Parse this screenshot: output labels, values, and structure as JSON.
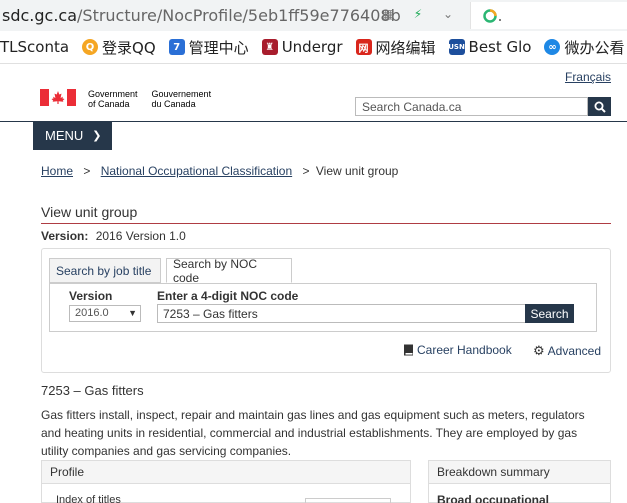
{
  "browser": {
    "url_host": "sdc.gc.ca",
    "url_path": "/Structure/NocProfile/5eb1ff59e776408b",
    "bookmarks": [
      {
        "label": "TLSconta",
        "icon": "document-icon",
        "color": "#ffffff"
      },
      {
        "label": "登录QQ",
        "icon": "qq-icon",
        "color": "#f5a623"
      },
      {
        "label": "管理中心",
        "icon": "seven-icon",
        "color": "#2a6fd6"
      },
      {
        "label": "Undergr",
        "icon": "shield-icon",
        "color": "#a81d2d"
      },
      {
        "label": "网络编辑",
        "icon": "net-icon",
        "color": "#d9261c"
      },
      {
        "label": "Best Glo",
        "icon": "usn-icon",
        "color": "#1d4f9c"
      },
      {
        "label": "微办公看",
        "icon": "bubble-icon",
        "color": "#1e88e5"
      }
    ]
  },
  "header": {
    "language_link": "Français",
    "gov_en_line1": "Government",
    "gov_en_line2": "of Canada",
    "gov_fr_line1": "Gouvernement",
    "gov_fr_line2": "du Canada",
    "search_placeholder": "Search Canada.ca",
    "menu_label": "MENU"
  },
  "breadcrumb": {
    "home": "Home",
    "noc": "National Occupational Classification",
    "current": "View unit group",
    "separator": ">"
  },
  "page": {
    "heading": "View unit group",
    "version_label": "Version:",
    "version_value": "2016 Version 1.0"
  },
  "search_panel": {
    "tab_job_title": "Search by job title",
    "tab_noc_code": "Search by NOC code",
    "version_label": "Version",
    "version_selected": "2016.0",
    "noc_label": "Enter a 4-digit NOC code",
    "noc_value": "7253 – Gas fitters",
    "search_button": "Search",
    "career_handbook": "Career Handbook",
    "advanced": "Advanced"
  },
  "unit_group": {
    "title": "7253 – Gas fitters",
    "description": "Gas fitters install, inspect, repair and maintain gas lines and gas equipment such as meters, regulators and heating units in residential, commercial and industrial establishments. They are employed by gas utility companies and gas servicing companies."
  },
  "profile": {
    "heading": "Profile",
    "index_label": "Index of titles"
  },
  "breakdown": {
    "heading": "Breakdown summary",
    "broad_label": "Broad occupational"
  },
  "colors": {
    "navy": "#26374a",
    "link": "#284162",
    "rule": "#af3c43"
  }
}
